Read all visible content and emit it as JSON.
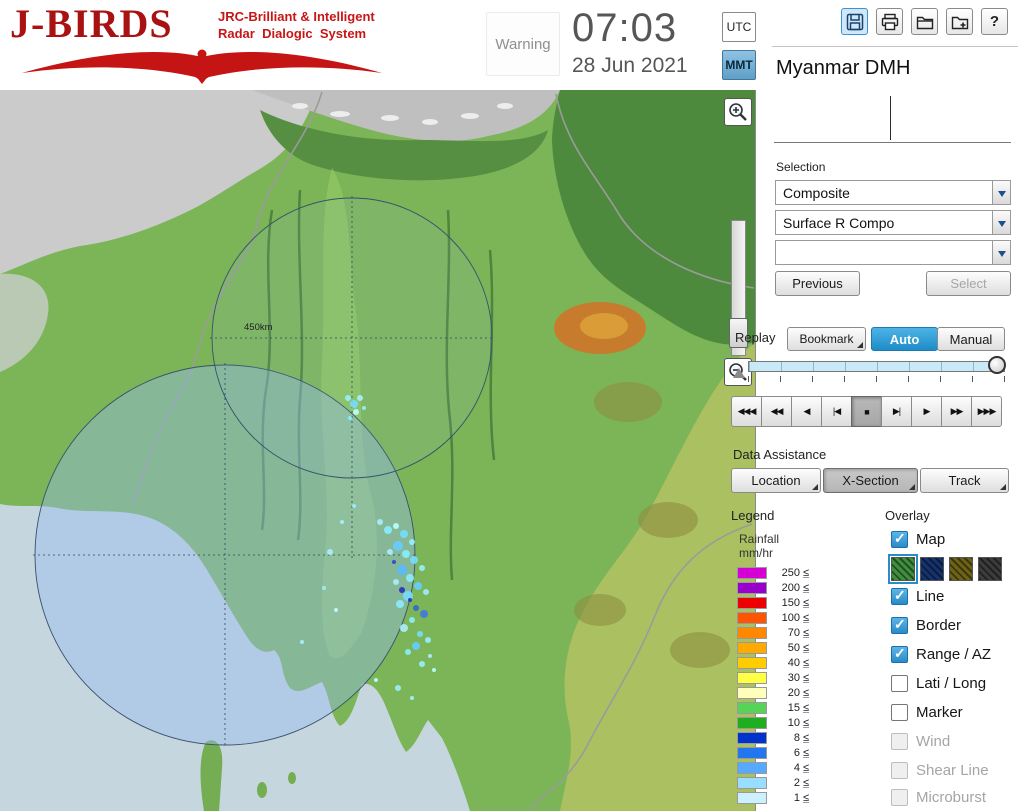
{
  "header": {
    "brand": "J-BIRDS",
    "tagline1": "JRC-Brilliant & Intelligent",
    "tagline2": "Radar  Dialogic  System",
    "warning": "Warning",
    "time": "07:03",
    "date": "28 Jun 2021",
    "tz": {
      "utc": "UTC",
      "mmt": "MMT"
    },
    "org": "Myanmar DMH",
    "help": "?"
  },
  "map": {
    "range_label": "450km"
  },
  "selection": {
    "label": "Selection",
    "combo1": "Composite",
    "combo2": "Surface R Compo",
    "combo3": "",
    "previous": "Previous",
    "select": "Select"
  },
  "replay": {
    "label": "Replay",
    "bookmark": "Bookmark",
    "auto": "Auto",
    "manual": "Manual",
    "transport": [
      "◀◀◀",
      "◀◀",
      "◀",
      "|◀",
      "■",
      "▶|",
      "▶",
      "▶▶",
      "▶▶▶"
    ]
  },
  "data_assistance": {
    "label": "Data Assistance",
    "location": "Location",
    "xsection": "X-Section",
    "track": "Track"
  },
  "legend": {
    "label": "Legend",
    "unit_line1": "Rainfall",
    "unit_line2": "mm/hr",
    "le": "≤",
    "rows": [
      {
        "value": "250",
        "color": "#d400d4"
      },
      {
        "value": "200",
        "color": "#9900cc"
      },
      {
        "value": "150",
        "color": "#ee0000"
      },
      {
        "value": "100",
        "color": "#ff5500"
      },
      {
        "value": "70",
        "color": "#ff8800"
      },
      {
        "value": "50",
        "color": "#ffaa00"
      },
      {
        "value": "40",
        "color": "#ffcc00"
      },
      {
        "value": "30",
        "color": "#ffff44"
      },
      {
        "value": "20",
        "color": "#ffffbb"
      },
      {
        "value": "15",
        "color": "#55d455"
      },
      {
        "value": "10",
        "color": "#1fae1f"
      },
      {
        "value": "8",
        "color": "#0033cc"
      },
      {
        "value": "6",
        "color": "#2277ee"
      },
      {
        "value": "4",
        "color": "#55aaff"
      },
      {
        "value": "2",
        "color": "#99ddff"
      },
      {
        "value": "1",
        "color": "#ccf0ff"
      }
    ]
  },
  "overlay": {
    "label": "Overlay",
    "map_styles": [
      "#3f8f3f",
      "#16336e",
      "#6e6216",
      "#3c3c3c"
    ],
    "items": [
      {
        "label": "Map",
        "checked": true,
        "enabled": true
      },
      {
        "label": "Line",
        "checked": true,
        "enabled": true
      },
      {
        "label": "Border",
        "checked": true,
        "enabled": true
      },
      {
        "label": "Range / AZ",
        "checked": true,
        "enabled": true
      },
      {
        "label": "Lati / Long",
        "checked": false,
        "enabled": true
      },
      {
        "label": "Marker",
        "checked": false,
        "enabled": true
      },
      {
        "label": "Wind",
        "checked": false,
        "enabled": false
      },
      {
        "label": "Shear Line",
        "checked": false,
        "enabled": false
      },
      {
        "label": "Microburst",
        "checked": false,
        "enabled": false
      }
    ]
  }
}
